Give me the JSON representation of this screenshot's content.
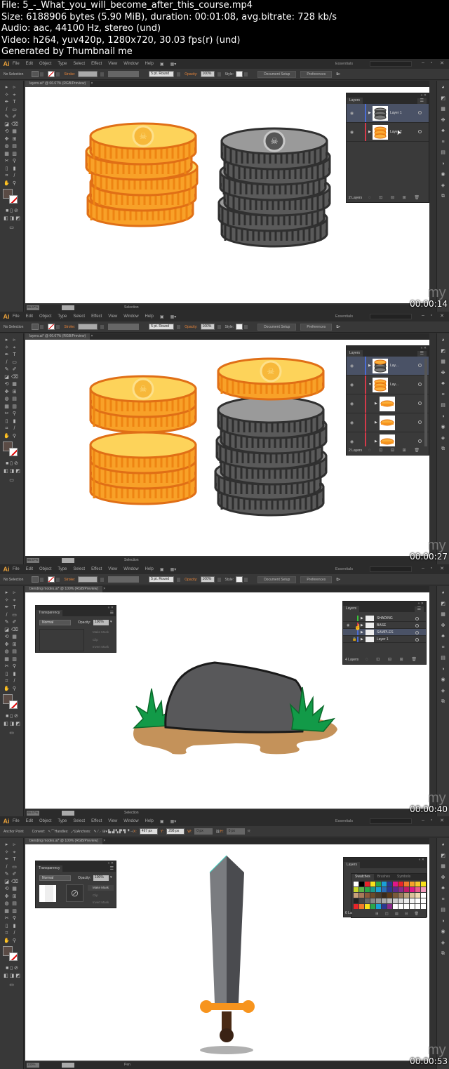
{
  "file_info": {
    "lines": [
      "File: 5_-_What_you_will_become_after_this_course.mp4",
      "Size: 6188906 bytes (5.90 MiB), duration: 00:01:08, avg.bitrate: 728 kb/s",
      "Audio: aac, 44100 Hz, stereo (und)",
      "Video: h264, yuv420p, 1280x720, 30.03 fps(r) (und)",
      "Generated by Thumbnail me"
    ]
  },
  "app": {
    "logo": "Ai",
    "menu": [
      "File",
      "Edit",
      "Object",
      "Type",
      "Select",
      "Effect",
      "View",
      "Window",
      "Help"
    ],
    "workspace": "Essentials",
    "window_buttons": [
      "minimize-icon",
      "maximize-icon",
      "close-icon"
    ]
  },
  "control_bar": {
    "selection_label": "No Selection",
    "stroke_label": "Stroke:",
    "brush": "5 pt. Round",
    "opacity_label": "Opacity:",
    "opacity_value": "100%",
    "style_label": "Style:",
    "document_setup": "Document Setup",
    "preferences": "Preferences"
  },
  "anchor_bar": {
    "label": "Anchor Point",
    "convert_label": "Convert:",
    "handles_label": "Handles:",
    "anchors_label": "Anchors:",
    "x_value": "497 px",
    "y_value": "298 px",
    "w_value": "0 px",
    "h_value": "0 px"
  },
  "frames": [
    {
      "doc_tab": "layers.ai* @ 66.67% (RGB/Preview)",
      "zoom": "66.67%",
      "page": "1",
      "status_mode": "Selection",
      "timestamp": "00:00:14",
      "layers_panel": {
        "title": "Layers",
        "rows": [
          {
            "name": "Layer 1",
            "color": "#4a6cd4",
            "selected": true,
            "thumb": "gray-coins"
          },
          {
            "name": "Layer 2",
            "color": "#d43a4a",
            "selected": false,
            "thumb": "gold-coins"
          }
        ],
        "footer": "2 Layers"
      }
    },
    {
      "doc_tab": "layers.ai* @ 66.67% (RGB/Preview)",
      "zoom": "66.67%",
      "page": "1",
      "status_mode": "Selection",
      "timestamp": "00:00:27",
      "layers_panel": {
        "title": "Layers",
        "rows": [
          {
            "name": "Lay...",
            "color": "#4a6cd4",
            "selected": true,
            "thumb": "mixed-coins",
            "expanded": false
          },
          {
            "name": "Lay...",
            "color": "#d43a4a",
            "selected": false,
            "thumb": "gold-coins",
            "expanded": true
          },
          {
            "name": "",
            "color": "#d43a4a",
            "selected": false,
            "thumb": "gold-coin",
            "sub": true
          },
          {
            "name": "",
            "color": "#d43a4a",
            "selected": false,
            "thumb": "gold-coin",
            "sub": true
          },
          {
            "name": "",
            "color": "#d43a4a",
            "selected": false,
            "thumb": "gold-coin",
            "sub": true
          }
        ],
        "footer": "2 Layers"
      }
    },
    {
      "doc_tab": "blending modes.ai* @ 100% (RGB/Preview)",
      "zoom": "66.67%",
      "page": "1",
      "status_mode": "Selection",
      "timestamp": "00:00:40",
      "transparency_panel": {
        "title": "Transparency",
        "blend_mode": "Normal",
        "opacity_label": "Opacity:",
        "opacity_value": "100%",
        "make_mask": "Make Mask",
        "clip": "Clip",
        "invert_mask": "Invert Mask"
      },
      "layers_panel": {
        "title": "Layers",
        "rows": [
          {
            "name": "SHADING",
            "color": "#3ac43a"
          },
          {
            "name": "BASE",
            "color": "#d43a4a"
          },
          {
            "name": "SAMPLES",
            "color": "#4a6cd4",
            "selected": true
          },
          {
            "name": "Layer 1",
            "color": "#4a6cd4",
            "locked": true
          }
        ],
        "footer": "4 Layers"
      }
    },
    {
      "doc_tab": "blending modes.ai* @ 100% (RGB/Preview)",
      "zoom": "100%",
      "page": "1",
      "status_mode": "Pen",
      "timestamp": "00:00:53",
      "transparency_panel": {
        "title": "Transparency",
        "blend_mode": "Normal",
        "opacity_label": "Opacity:",
        "opacity_value": "100%",
        "make_mask": "Make Mask",
        "clip": "Clip",
        "invert_mask": "Invert Mask"
      },
      "swatches_panel": {
        "layers_tab": "Layers",
        "tabs": [
          "Swatches",
          "Brushes",
          "Symbols"
        ],
        "footer_prefix": "6 La",
        "colors": [
          "#ffffff",
          "#000000",
          "#e8242a",
          "#f9e11a",
          "#29a74a",
          "#1aa0d8",
          "#2a3890",
          "#e0168a",
          "#e8242a",
          "#f07a2a",
          "#f5a12a",
          "#f7c62a",
          "#f9e11a",
          "#c9d82a",
          "#5ab44a",
          "#29a74a",
          "#1a9a8a",
          "#1aa0d8",
          "#2a6cb4",
          "#2a3890",
          "#5a2a8a",
          "#8a2a8a",
          "#c21a6a",
          "#e0168a",
          "#e85a8a",
          "#f09aba",
          "#c8a07a",
          "#a87a5a",
          "#8a5a3a",
          "#6a4a2a",
          "#4a3a2a",
          "#3a2a1a",
          "#5a3a1a",
          "#7a5a3a",
          "#9a7a5a",
          "#baa07a",
          "#dac09a",
          "#f0d8b0",
          "#ffffff",
          "#222222",
          "#444444",
          "#666666",
          "#888888",
          "#999999",
          "#aaaaaa",
          "#bbbbbb",
          "#cccccc",
          "#dddddd",
          "#eeeeee",
          "#f5f5f5",
          "#ffffff",
          "#ffffff",
          "#e8242a",
          "#f07a2a",
          "#f9e11a",
          "#29a74a",
          "#1aa0d8",
          "#2a3890",
          "#8a2a8a",
          "#ffffff",
          "#ffffff",
          "#ffffff",
          "#ffffff",
          "#ffffff",
          "#ffffff"
        ]
      }
    }
  ],
  "watermark": "my"
}
